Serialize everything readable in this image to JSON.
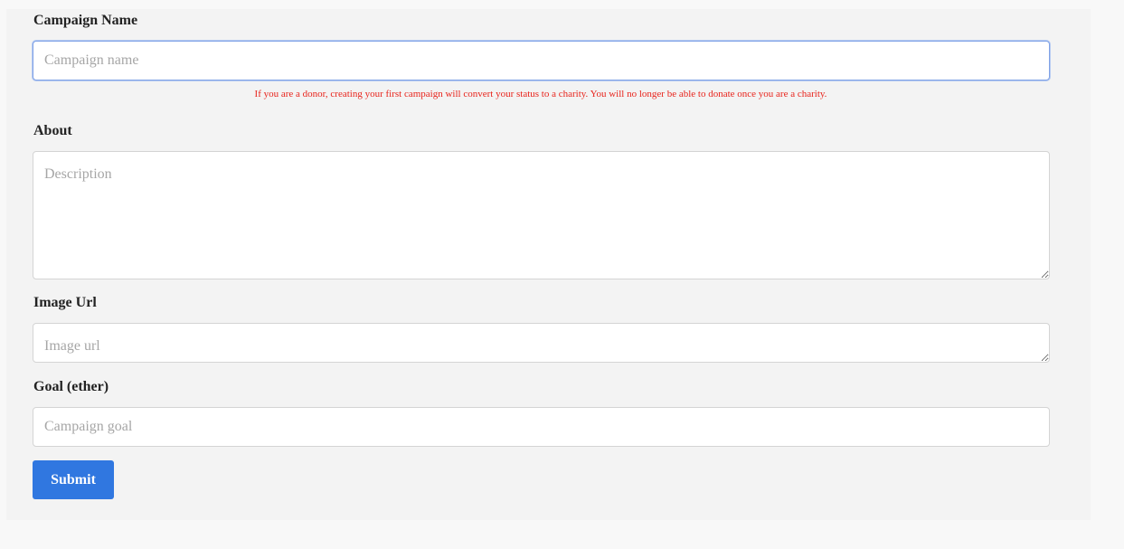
{
  "form": {
    "campaign_name": {
      "label": "Campaign Name",
      "placeholder": "Campaign name",
      "value": ""
    },
    "warning": "If you are a donor, creating your first campaign will convert your status to a charity. You will no longer be able to donate once you are a charity.",
    "about": {
      "label": "About",
      "placeholder": "Description",
      "value": ""
    },
    "image_url": {
      "label": "Image Url",
      "placeholder": "Image url",
      "value": ""
    },
    "goal": {
      "label": "Goal (ether)",
      "placeholder": "Campaign goal",
      "value": ""
    },
    "submit_label": "Submit"
  },
  "colors": {
    "accent": "#3077e0",
    "warning": "#e8241c",
    "focus_border": "#7fa2e6"
  }
}
